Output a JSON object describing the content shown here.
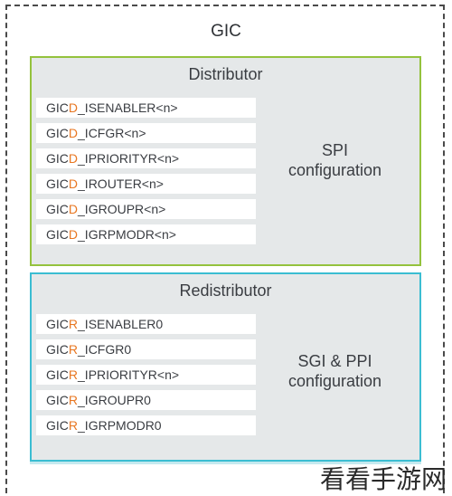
{
  "gic": {
    "title": "GIC"
  },
  "distributor": {
    "title": "Distributor",
    "config_line1": "SPI",
    "config_line2": "configuration",
    "border_color": "#94c23d",
    "registers": [
      {
        "prefix": "GIC",
        "highlight": "D",
        "suffix": "_ISENABLER<n>"
      },
      {
        "prefix": "GIC",
        "highlight": "D",
        "suffix": "_ICFGR<n>"
      },
      {
        "prefix": "GIC",
        "highlight": "D",
        "suffix": "_IPRIORITYR<n>"
      },
      {
        "prefix": "GIC",
        "highlight": "D",
        "suffix": "_IROUTER<n>"
      },
      {
        "prefix": "GIC",
        "highlight": "D",
        "suffix": "_IGROUPR<n>"
      },
      {
        "prefix": "GIC",
        "highlight": "D",
        "suffix": "_IGRPMODR<n>"
      }
    ]
  },
  "redistributor": {
    "title": "Redistributor",
    "config_line1": "SGI & PPI",
    "config_line2": "configuration",
    "border_color": "#3bbdd2",
    "registers": [
      {
        "prefix": "GIC",
        "highlight": "R",
        "suffix": "_ISENABLER0"
      },
      {
        "prefix": "GIC",
        "highlight": "R",
        "suffix": "_ICFGR0"
      },
      {
        "prefix": "GIC",
        "highlight": "R",
        "suffix": "_IPRIORITYR<n>"
      },
      {
        "prefix": "GIC",
        "highlight": "R",
        "suffix": "_IGROUPR0"
      },
      {
        "prefix": "GIC",
        "highlight": "R",
        "suffix": "_IGRPMODR0"
      }
    ]
  },
  "highlight_color": "#e87722",
  "watermark": "看看手游网"
}
